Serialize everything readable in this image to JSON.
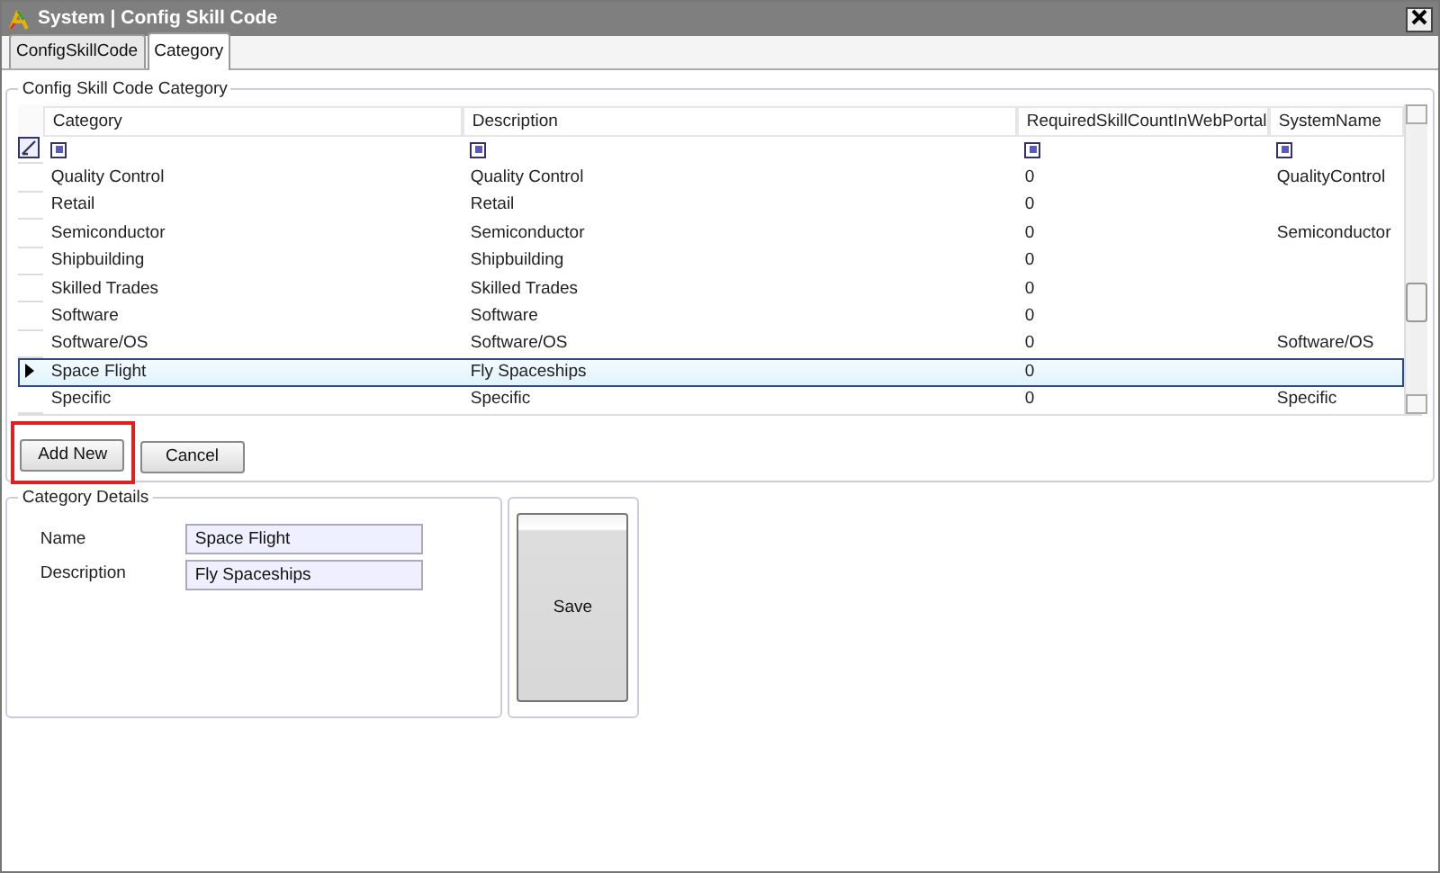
{
  "window": {
    "title": "System | Config Skill Code"
  },
  "tabs": [
    {
      "label": "ConfigSkillCode",
      "selected": false
    },
    {
      "label": "Category",
      "selected": true
    }
  ],
  "category_group": {
    "title": "Config Skill Code Category",
    "table": {
      "columns": [
        "Category",
        "Description",
        "RequiredSkillCountInWebPortal",
        "SystemName"
      ],
      "rows": [
        {
          "cells": [
            "Quality Control",
            "Quality Control",
            "0",
            "QualityControl"
          ],
          "selected": false
        },
        {
          "cells": [
            "Retail",
            "Retail",
            "0",
            ""
          ],
          "selected": false
        },
        {
          "cells": [
            "Semiconductor",
            "Semiconductor",
            "0",
            "Semiconductor"
          ],
          "selected": false
        },
        {
          "cells": [
            "Shipbuilding",
            "Shipbuilding",
            "0",
            ""
          ],
          "selected": false
        },
        {
          "cells": [
            "Skilled Trades",
            "Skilled Trades",
            "0",
            ""
          ],
          "selected": false
        },
        {
          "cells": [
            "Software",
            "Software",
            "0",
            ""
          ],
          "selected": false
        },
        {
          "cells": [
            "Software/OS",
            "Software/OS",
            "0",
            "Software/OS"
          ],
          "selected": false
        },
        {
          "cells": [
            "Space Flight",
            "Fly Spaceships",
            "0",
            ""
          ],
          "selected": true
        },
        {
          "cells": [
            "Specific",
            "Specific",
            "0",
            "Specific"
          ],
          "selected": false
        }
      ]
    },
    "buttons": [
      {
        "label": "Add New",
        "highlighted": true
      },
      {
        "label": "Cancel",
        "highlighted": false
      }
    ]
  },
  "details": {
    "title": "Category Details",
    "fields": [
      {
        "label": "Name",
        "value": "Space Flight"
      },
      {
        "label": "Description",
        "value": "Fly Spaceships"
      }
    ]
  },
  "save_button": {
    "label": "Save"
  }
}
